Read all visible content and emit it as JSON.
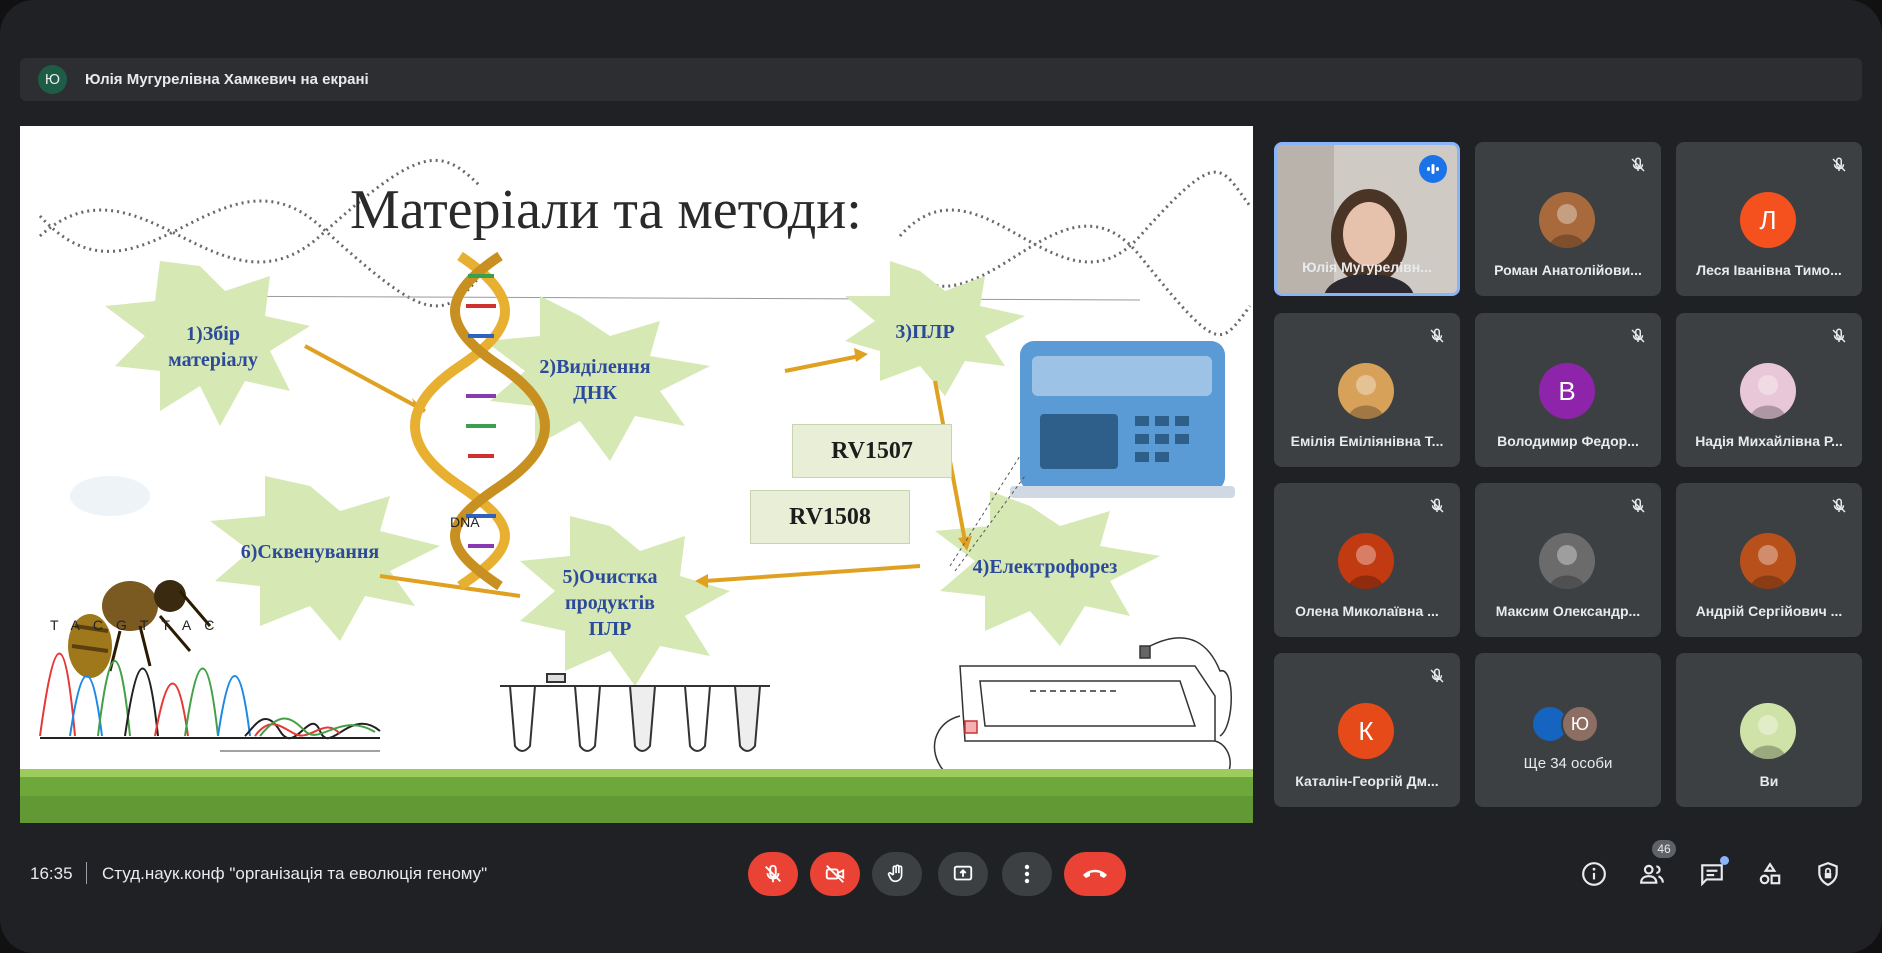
{
  "presenter": {
    "initial": "Ю",
    "text": "Юлія Мугурелівна Хамкевич на екрані"
  },
  "slide": {
    "title": "Матеріали та методи:",
    "steps": [
      "1)Збір\nматеріалу",
      "2)Виділення\nДНК",
      "3)ПЛР",
      "4)Електрофорез",
      "5)Очистка\nпродуктів\nПЛР",
      "6)Сквенування"
    ],
    "primers": [
      "RV1507",
      "RV1508"
    ],
    "dna_label": "DNA",
    "sequence": "TACGTTAC"
  },
  "participants": [
    {
      "name": "Юлія Мугурелівн...",
      "speaking": true,
      "type": "video"
    },
    {
      "name": "Роман Анатолійови...",
      "type": "photo",
      "color": "#a86a3c"
    },
    {
      "name": "Леся Іванівна Тимо...",
      "initial": "Л",
      "color": "#f4511e"
    },
    {
      "name": "Емілія Еміліянівна Т...",
      "type": "photo",
      "color": "#d7a15a"
    },
    {
      "name": "Володимир Федор...",
      "initial": "В",
      "color": "#8e24aa"
    },
    {
      "name": "Надія Михайлівна Р...",
      "type": "photo",
      "color": "#e8c8d8"
    },
    {
      "name": "Олена Миколаївна ...",
      "type": "photo",
      "color": "#c23a12"
    },
    {
      "name": "Максим Олександр...",
      "type": "photo",
      "color": "#6b6b6b"
    },
    {
      "name": "Андрій Сергійович ...",
      "type": "photo",
      "color": "#b8501c"
    },
    {
      "name": "Каталін-Георгій Дм...",
      "initial": "К",
      "color": "#e64a19"
    },
    {
      "name": "Ще 34 особи",
      "type": "more"
    },
    {
      "name": "Ви",
      "type": "photo",
      "color": "#cfe3a8"
    }
  ],
  "more_tile": {
    "initial": "Ю"
  },
  "bottom": {
    "time": "16:35",
    "meeting": "Студ.наук.конф \"організація та еволюція геному\"",
    "people_count": "46"
  },
  "icons": [
    "mic-off-icon",
    "camera-off-icon",
    "raise-hand-icon",
    "present-screen-icon",
    "more-options-icon",
    "end-call-icon",
    "info-icon",
    "people-icon",
    "chat-icon",
    "activities-icon",
    "host-controls-icon"
  ]
}
